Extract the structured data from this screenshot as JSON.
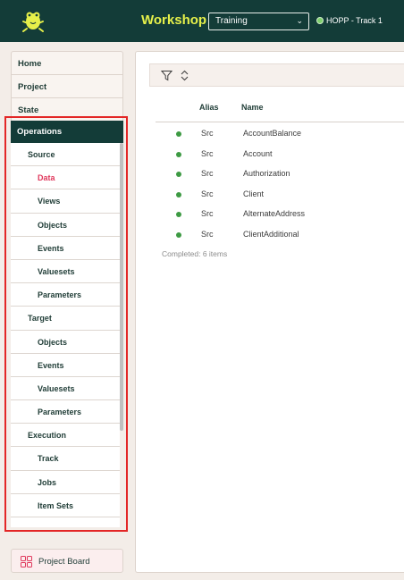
{
  "header": {
    "app_title": "Workshop",
    "environment_select": {
      "value": "Training"
    },
    "track_status": {
      "label": "HOPP - Track 1",
      "color": "#7fcf6e"
    },
    "logo_icon": "frog-logo-icon"
  },
  "sidebar": {
    "top_items": [
      {
        "label": "Home"
      },
      {
        "label": "Project"
      },
      {
        "label": "State"
      }
    ],
    "operations": {
      "label": "Operations",
      "rows": [
        {
          "label": "Source",
          "kind": "group"
        },
        {
          "label": "Data",
          "kind": "sub",
          "active": true
        },
        {
          "label": "Views",
          "kind": "sub"
        },
        {
          "label": "Objects",
          "kind": "sub"
        },
        {
          "label": "Events",
          "kind": "sub"
        },
        {
          "label": "Valuesets",
          "kind": "sub"
        },
        {
          "label": "Parameters",
          "kind": "sub"
        },
        {
          "label": "Target",
          "kind": "group"
        },
        {
          "label": "Objects",
          "kind": "sub"
        },
        {
          "label": "Events",
          "kind": "sub"
        },
        {
          "label": "Valuesets",
          "kind": "sub"
        },
        {
          "label": "Parameters",
          "kind": "sub"
        },
        {
          "label": "Execution",
          "kind": "group"
        },
        {
          "label": "Track",
          "kind": "sub"
        },
        {
          "label": "Jobs",
          "kind": "sub"
        },
        {
          "label": "Item Sets",
          "kind": "sub"
        },
        {
          "label": "",
          "kind": "sub"
        }
      ]
    },
    "project_board": {
      "label": "Project Board",
      "icon": "grid-icon"
    }
  },
  "main": {
    "toolbar": {
      "icons": [
        "filter-icon",
        "sort-icon"
      ]
    },
    "columns": {
      "alias": "Alias",
      "name": "Name"
    },
    "rows": [
      {
        "alias": "Src",
        "name": "AccountBalance",
        "status_color": "#3d9a43"
      },
      {
        "alias": "Src",
        "name": "Account",
        "status_color": "#3d9a43"
      },
      {
        "alias": "Src",
        "name": "Authorization",
        "status_color": "#3d9a43"
      },
      {
        "alias": "Src",
        "name": "Client",
        "status_color": "#3d9a43"
      },
      {
        "alias": "Src",
        "name": "AlternateAddress",
        "status_color": "#3d9a43"
      },
      {
        "alias": "Src",
        "name": "ClientAdditional",
        "status_color": "#3d9a43"
      }
    ],
    "status_text": "Completed: 6 items"
  },
  "colors": {
    "header_bg": "#133c38",
    "accent_yellow": "#e6f04a",
    "active_link": "#e0385c",
    "highlight_border": "#e32626"
  }
}
